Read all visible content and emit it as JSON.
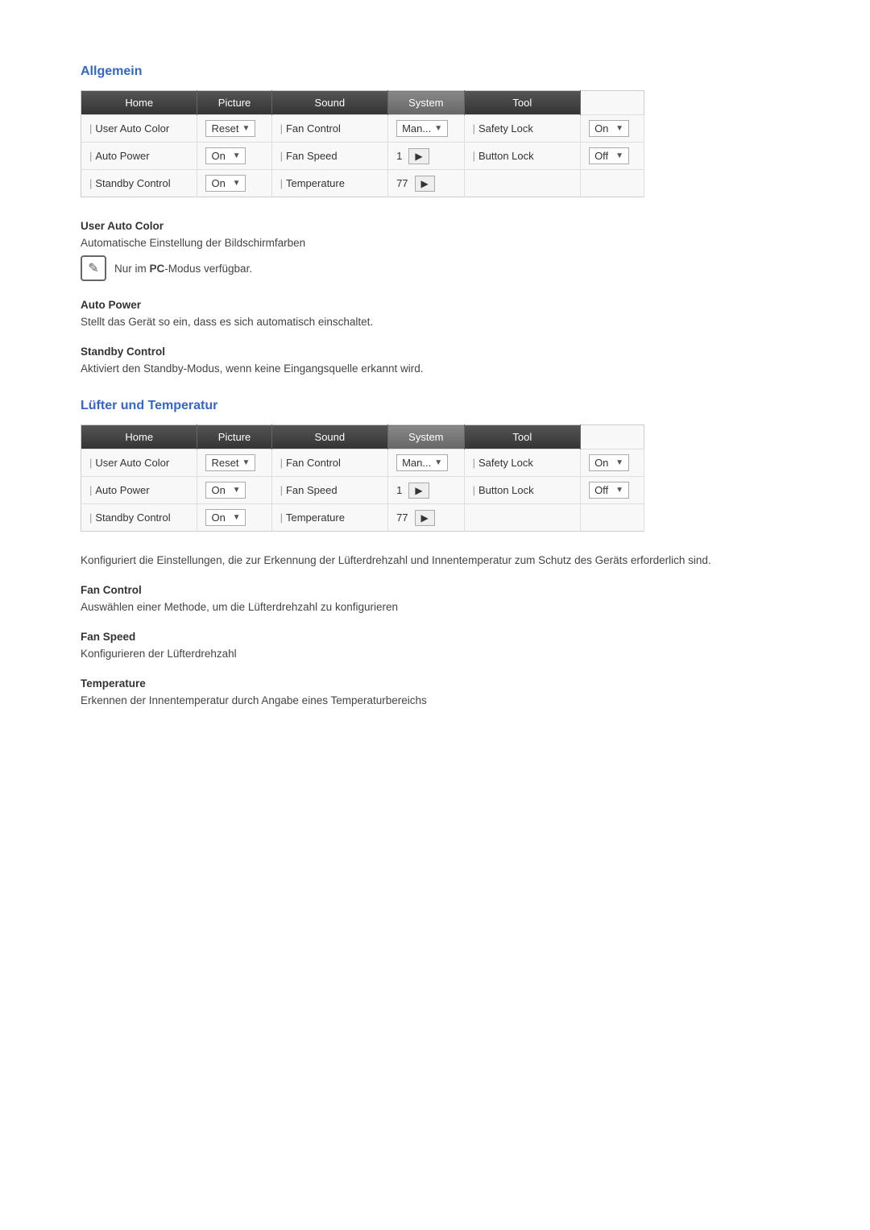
{
  "sections": [
    {
      "id": "allgemein",
      "title": "Allgemein",
      "tabs": [
        "Home",
        "Picture",
        "Sound",
        "System",
        "Tool"
      ],
      "active_tab": "System",
      "rows": [
        {
          "col1_label": "User Auto Color",
          "col1_control_type": "dropdown",
          "col1_value": "Reset",
          "col2_label": "Fan Control",
          "col2_control_type": "dropdown",
          "col2_value": "Man...",
          "col3_label": "Safety Lock",
          "col3_control_type": "dropdown",
          "col3_value": "On"
        },
        {
          "col1_label": "Auto Power",
          "col1_control_type": "dropdown",
          "col1_value": "On",
          "col2_label": "Fan Speed",
          "col2_control_type": "arrow",
          "col2_value": "1",
          "col3_label": "Button Lock",
          "col3_control_type": "dropdown",
          "col3_value": "Off"
        },
        {
          "col1_label": "Standby Control",
          "col1_control_type": "dropdown",
          "col1_value": "On",
          "col2_label": "Temperature",
          "col2_control_type": "arrow",
          "col2_value": "77",
          "col3_label": null,
          "col3_control_type": null,
          "col3_value": null
        }
      ],
      "items": [
        {
          "heading": "User Auto Color",
          "desc": "Automatische Einstellung der Bildschirmfarben",
          "note": "Nur im PC-Modus verfügbar.",
          "has_note": true
        },
        {
          "heading": "Auto Power",
          "desc": "Stellt das Gerät so ein, dass es sich automatisch einschaltet.",
          "has_note": false
        },
        {
          "heading": "Standby Control",
          "desc": "Aktiviert den Standby-Modus, wenn keine Eingangsquelle erkannt wird.",
          "has_note": false
        }
      ]
    },
    {
      "id": "luefter",
      "title": "Lüfter und Temperatur",
      "tabs": [
        "Home",
        "Picture",
        "Sound",
        "System",
        "Tool"
      ],
      "active_tab": "System",
      "rows": [
        {
          "col1_label": "User Auto Color",
          "col1_control_type": "dropdown",
          "col1_value": "Reset",
          "col2_label": "Fan Control",
          "col2_control_type": "dropdown",
          "col2_value": "Man...",
          "col3_label": "Safety Lock",
          "col3_control_type": "dropdown",
          "col3_value": "On"
        },
        {
          "col1_label": "Auto Power",
          "col1_control_type": "dropdown",
          "col1_value": "On",
          "col2_label": "Fan Speed",
          "col2_control_type": "arrow",
          "col2_value": "1",
          "col3_label": "Button Lock",
          "col3_control_type": "dropdown",
          "col3_value": "Off"
        },
        {
          "col1_label": "Standby Control",
          "col1_control_type": "dropdown",
          "col1_value": "On",
          "col2_label": "Temperature",
          "col2_control_type": "arrow",
          "col2_value": "77",
          "col3_label": null,
          "col3_control_type": null,
          "col3_value": null
        }
      ],
      "intro": "Konfiguriert die Einstellungen, die zur Erkennung der Lüfterdrehzahl und Innentemperatur zum Schutz des Geräts erforderlich sind.",
      "items": [
        {
          "heading": "Fan Control",
          "desc": "Auswählen einer Methode, um die Lüfterdrehzahl zu konfigurieren",
          "has_note": false
        },
        {
          "heading": "Fan Speed",
          "desc": "Konfigurieren der Lüfterdrehzahl",
          "has_note": false
        },
        {
          "heading": "Temperature",
          "desc": "Erkennen der Innentemperatur durch Angabe eines Temperaturbereichs",
          "has_note": false
        }
      ]
    }
  ],
  "note_icon": "✎",
  "note_text_prefix": "Nur im ",
  "note_text_bold": "PC",
  "note_text_suffix": "-Modus verfügbar."
}
